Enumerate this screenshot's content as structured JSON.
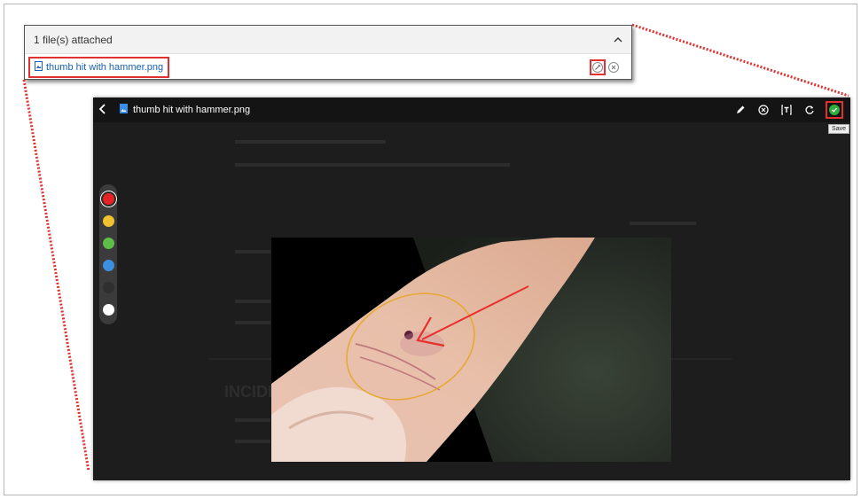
{
  "attachments": {
    "header": "1 file(s) attached",
    "collapse_icon": "chevron-up-icon",
    "file_name": "thumb hit with hammer.png",
    "file_icon": "image-file-icon",
    "annotate_icon": "annotate-icon",
    "remove_icon": "close-circle-icon"
  },
  "viewer": {
    "title": "thumb hit with hammer.png",
    "back_icon": "back-arrow-icon",
    "tools": [
      "pencil-icon",
      "clear-icon",
      "text-icon",
      "rotate-icon",
      "save-icon"
    ],
    "save_tooltip": "Save",
    "background_heading": "INCIDE"
  },
  "palette": {
    "colors": [
      "#e52224",
      "#f2c230",
      "#5dbd48",
      "#3d8fe0",
      "#2f2f2f",
      "#ffffff"
    ],
    "selected": "#e52224"
  },
  "annotation_colors": {
    "arrow": "#e8302a",
    "circle": "#e6a82e",
    "callout_border": "#e03030"
  }
}
